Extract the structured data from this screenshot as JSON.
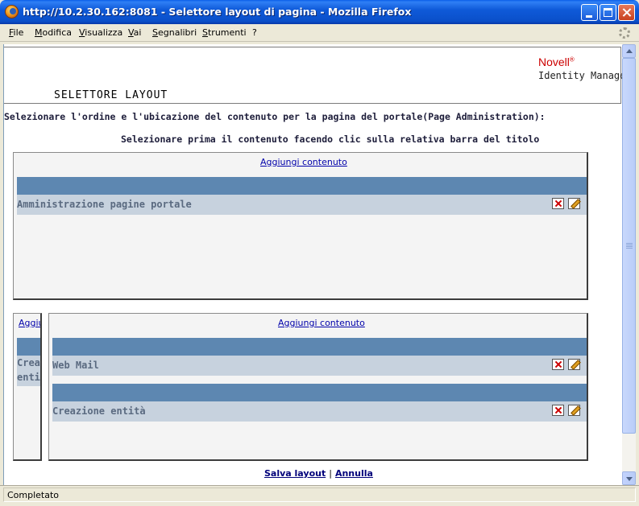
{
  "window": {
    "title": "http://10.2.30.162:8081 - Selettore layout di pagina - Mozilla Firefox",
    "buttons": {
      "minimize": "minimize",
      "maximize": "maximize",
      "close": "close"
    }
  },
  "menubar": {
    "items": [
      "File",
      "Modifica",
      "Visualizza",
      "Vai",
      "Segnalibri",
      "Strumenti",
      "?"
    ]
  },
  "header": {
    "brand": "Novell",
    "brand_mark": "®",
    "product": "Identity Manager",
    "title": "SELETTORE LAYOUT"
  },
  "intro": "Selezionare l'ordine e l'ubicazione del contenuto per la pagina del portale(Page Administration):",
  "hint": "Selezionare prima il contenuto facendo clic sulla relativa barra del titolo",
  "panels": {
    "top": {
      "add_link": "Aggiungi contenuto",
      "portlets": [
        {
          "label": "Amministrazione pagine portale"
        }
      ]
    },
    "left": {
      "add_link": "Aggiu",
      "portlets": [
        {
          "label_line1": "Crea",
          "label_line2": "entit"
        }
      ]
    },
    "right": {
      "add_link": "Aggiungi contenuto",
      "portlets": [
        {
          "label": "Web Mail"
        },
        {
          "label": "Creazione entità"
        }
      ]
    }
  },
  "footer": {
    "save": "Salva layout",
    "separator": "|",
    "cancel": "Annulla"
  },
  "status": {
    "text": "Completato"
  },
  "colors": {
    "titlebar": "#0a4fc9",
    "portlet_bar": "#5d87b1",
    "portlet_row": "#c7d2de",
    "brand": "#cc0000"
  }
}
